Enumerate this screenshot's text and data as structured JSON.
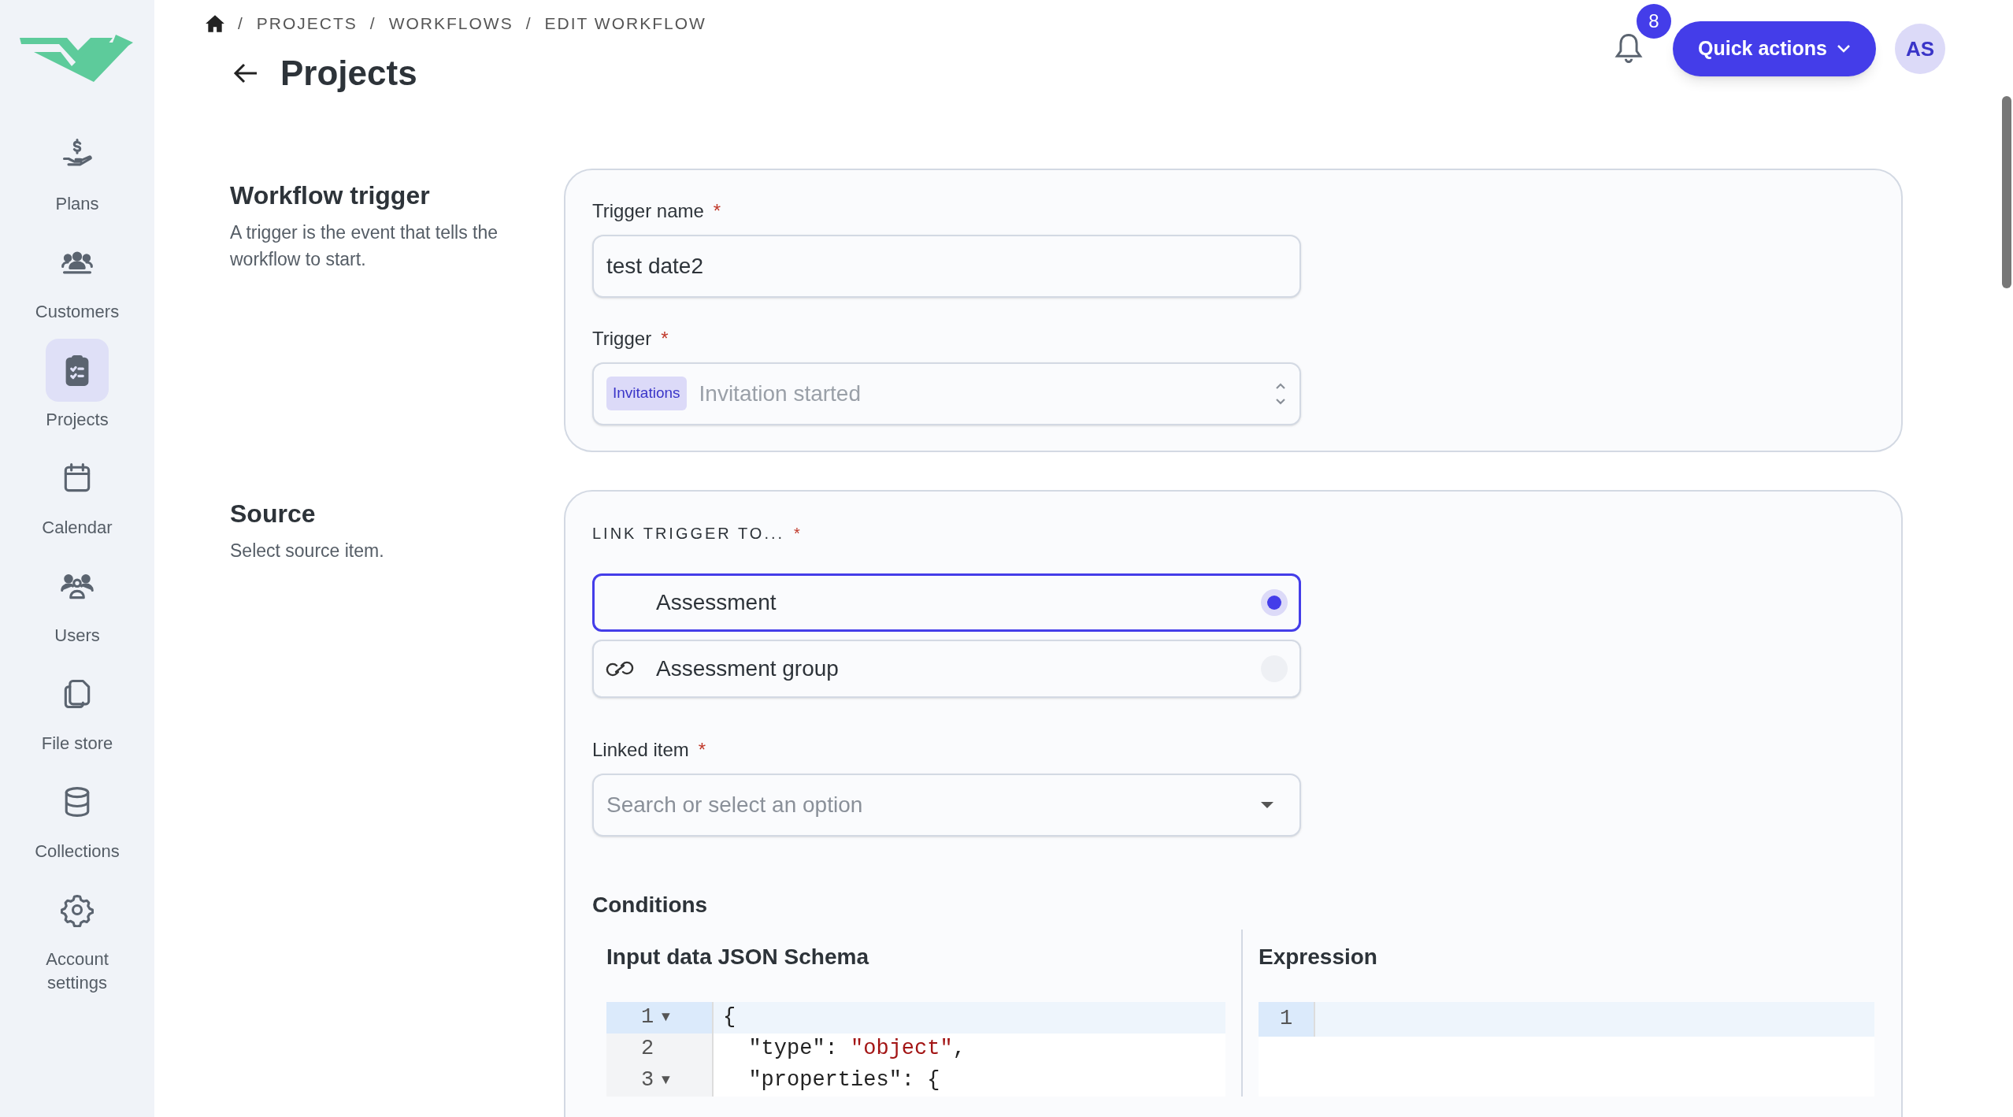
{
  "sidebar": {
    "items": [
      {
        "kind": "plans",
        "label": "Plans",
        "selected": false
      },
      {
        "kind": "customers",
        "label": "Customers",
        "selected": false
      },
      {
        "kind": "projects",
        "label": "Projects",
        "selected": true
      },
      {
        "kind": "calendar",
        "label": "Calendar",
        "selected": false
      },
      {
        "kind": "users",
        "label": "Users",
        "selected": false
      },
      {
        "kind": "files",
        "label": "File store",
        "selected": false
      },
      {
        "kind": "collections",
        "label": "Collections",
        "selected": false
      },
      {
        "kind": "settings",
        "label": "Account settings",
        "selected": false
      }
    ]
  },
  "breadcrumb": [
    {
      "separator": "/",
      "label": "PROJECTS"
    },
    {
      "separator": "/",
      "label": "WORKFLOWS"
    },
    {
      "separator": "/",
      "label": "EDIT WORKFLOW"
    }
  ],
  "page_title": "Projects",
  "notifications": {
    "count": "8"
  },
  "quick_actions": "Quick actions",
  "avatar": "AS",
  "trigger_section": {
    "title": "Workflow trigger",
    "description": "A trigger is the event that tells the workflow to start.",
    "name_label": "Trigger name",
    "name_required": "*",
    "name_value": "test date2",
    "trigger_label": "Trigger",
    "trigger_required": "*",
    "trigger_tag": "Invitations",
    "trigger_value": "Invitation started"
  },
  "source_section": {
    "title": "Source",
    "description": "Select source item.",
    "link_label": "LINK TRIGGER TO...",
    "link_required": "*",
    "options": [
      {
        "label": "Assessment",
        "selected": true,
        "kind": "plain"
      },
      {
        "label": "Assessment group",
        "selected": false,
        "kind": "link"
      }
    ],
    "linked_label": "Linked item",
    "linked_required": "*",
    "linked_placeholder": "Search or select an option",
    "conditions_title": "Conditions",
    "schema_title": "Input data JSON Schema",
    "schema_lines": [
      {
        "number": "1",
        "fold_marker": "▼",
        "active": true,
        "tokens": [
          {
            "kind": "plain",
            "text": "{"
          }
        ]
      },
      {
        "number": "2",
        "active": false,
        "tokens": [
          {
            "kind": "plain",
            "text": "  \"type\": "
          },
          {
            "kind": "string",
            "text": "\"object\""
          },
          {
            "kind": "plain",
            "text": ","
          }
        ]
      },
      {
        "number": "3",
        "fold_marker": "▼",
        "active": false,
        "tokens": [
          {
            "kind": "plain",
            "text": "  \"properties\": {"
          }
        ]
      }
    ],
    "expression_title": "Expression",
    "expression_lines": [
      {
        "number": "1",
        "active": true
      }
    ]
  }
}
